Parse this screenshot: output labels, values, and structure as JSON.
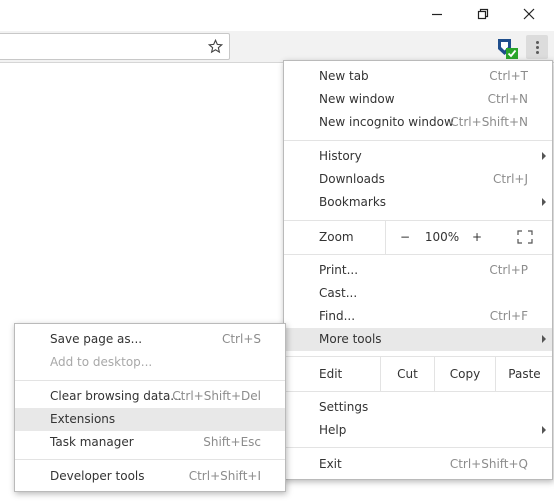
{
  "window": {
    "minimize": "—",
    "restore": "❐",
    "close": "✕"
  },
  "toolbar": {
    "star_icon": "star-icon",
    "menu_icon": "kebab-icon"
  },
  "main_menu": {
    "new_tab": {
      "label": "New tab",
      "shortcut": "Ctrl+T"
    },
    "new_window": {
      "label": "New window",
      "shortcut": "Ctrl+N"
    },
    "new_incognito": {
      "label": "New incognito window",
      "shortcut": "Ctrl+Shift+N"
    },
    "history": {
      "label": "History"
    },
    "downloads": {
      "label": "Downloads",
      "shortcut": "Ctrl+J"
    },
    "bookmarks": {
      "label": "Bookmarks"
    },
    "zoom": {
      "label": "Zoom",
      "minus": "−",
      "value": "100%",
      "plus": "+"
    },
    "print": {
      "label": "Print...",
      "shortcut": "Ctrl+P"
    },
    "cast": {
      "label": "Cast..."
    },
    "find": {
      "label": "Find...",
      "shortcut": "Ctrl+F"
    },
    "more_tools": {
      "label": "More tools"
    },
    "edit": {
      "label": "Edit",
      "cut": "Cut",
      "copy": "Copy",
      "paste": "Paste"
    },
    "settings": {
      "label": "Settings"
    },
    "help": {
      "label": "Help"
    },
    "exit": {
      "label": "Exit",
      "shortcut": "Ctrl+Shift+Q"
    }
  },
  "sub_menu": {
    "save_page": {
      "label": "Save page as...",
      "shortcut": "Ctrl+S"
    },
    "add_desktop": {
      "label": "Add to desktop..."
    },
    "clear_data": {
      "label": "Clear browsing data...",
      "shortcut": "Ctrl+Shift+Del"
    },
    "extensions": {
      "label": "Extensions"
    },
    "task_manager": {
      "label": "Task manager",
      "shortcut": "Shift+Esc"
    },
    "dev_tools": {
      "label": "Developer tools",
      "shortcut": "Ctrl+Shift+I"
    }
  },
  "colors": {
    "highlight": "#e8e8e8",
    "badge_green": "#2aa52a",
    "ext_blue": "#1f4e8c"
  }
}
